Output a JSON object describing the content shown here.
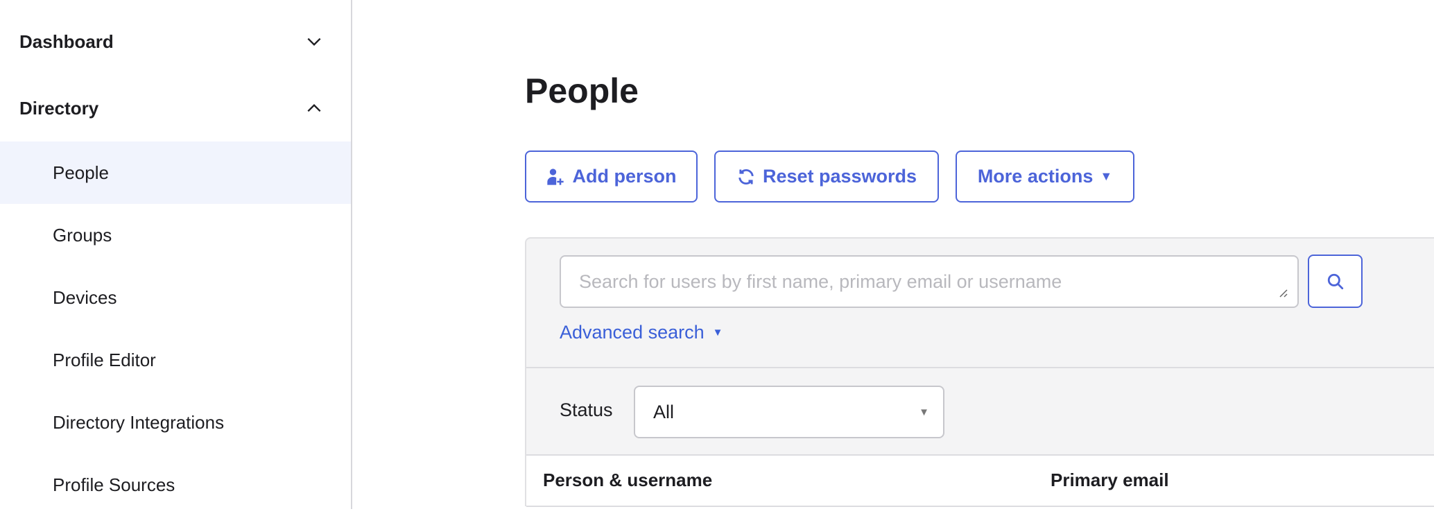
{
  "sidebar": {
    "sections": [
      {
        "label": "Dashboard",
        "icon": "chevron-down-icon",
        "expanded": false
      },
      {
        "label": "Directory",
        "icon": "chevron-up-icon",
        "expanded": true
      }
    ],
    "items": [
      {
        "label": "People",
        "active": true
      },
      {
        "label": "Groups"
      },
      {
        "label": "Devices"
      },
      {
        "label": "Profile Editor"
      },
      {
        "label": "Directory Integrations"
      },
      {
        "label": "Profile Sources"
      }
    ]
  },
  "page": {
    "title": "People"
  },
  "toolbar": {
    "add_person": "Add person",
    "reset_passwords": "Reset passwords",
    "more_actions": "More actions"
  },
  "search": {
    "placeholder": "Search for users by first name, primary email or username",
    "value": "",
    "advanced": "Advanced search"
  },
  "filter": {
    "status_label": "Status",
    "status_value": "All"
  },
  "table": {
    "columns": [
      "Person & username",
      "Primary email"
    ]
  },
  "colors": {
    "accent": "#4c64d9",
    "active_bg": "#f1f4fd",
    "panel_bg": "#f4f4f5"
  }
}
